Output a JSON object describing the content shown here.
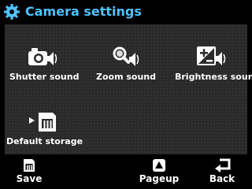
{
  "header": {
    "title": "Camera settings",
    "icon": "gear-icon",
    "accent": "#4fc3ff"
  },
  "items": [
    {
      "label": "Shutter sound",
      "icon": "camera-sound-icon"
    },
    {
      "label": "Zoom sound",
      "icon": "zoom-sound-icon"
    },
    {
      "label": "Brightness sound",
      "icon": "brightness-sound-icon"
    },
    {
      "label": "Default storage",
      "icon": "memory-card-icon"
    }
  ],
  "softkeys": {
    "left": {
      "label": "Save",
      "icon": "memory-card-icon"
    },
    "center": {
      "label": "Pageup",
      "icon": "up-arrow-icon"
    },
    "right": {
      "label": "Back",
      "icon": "back-arrow-icon"
    }
  }
}
